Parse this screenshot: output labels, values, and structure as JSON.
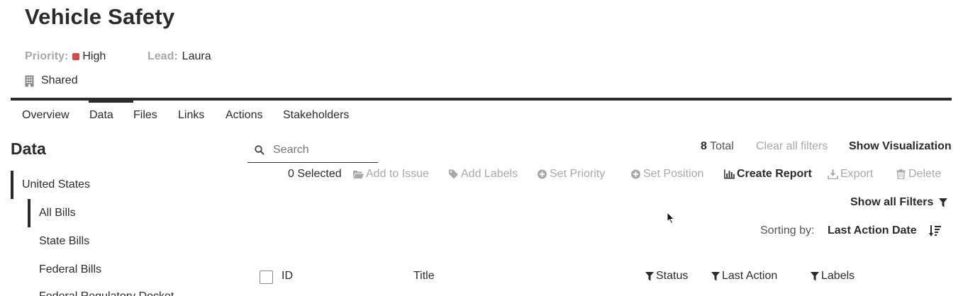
{
  "page": {
    "title": "Vehicle Safety"
  },
  "meta": {
    "priority_label": "Priority:",
    "priority_value": "High",
    "priority_color": "#d24b4b",
    "lead_label": "Lead:",
    "lead_value": "Laura",
    "visibility": "Shared",
    "visibility_icon": "building-icon"
  },
  "tabs": [
    {
      "label": "Overview",
      "active": false
    },
    {
      "label": "Data",
      "active": true
    },
    {
      "label": "Files",
      "active": false
    },
    {
      "label": "Links",
      "active": false
    },
    {
      "label": "Actions",
      "active": false
    },
    {
      "label": "Stakeholders",
      "active": false
    }
  ],
  "sidebar": {
    "heading": "Data",
    "items": [
      {
        "label": "United States",
        "level": 1,
        "selected": true
      },
      {
        "label": "All Bills",
        "level": 2,
        "selected": true
      },
      {
        "label": "State Bills",
        "level": 2,
        "selected": false
      },
      {
        "label": "Federal Bills",
        "level": 2,
        "selected": false
      },
      {
        "label": "Federal Regulatory Docket",
        "level": 2,
        "selected": false
      }
    ]
  },
  "search": {
    "placeholder": "Search",
    "value": "",
    "icon": "search-icon"
  },
  "summary": {
    "total_count": "8",
    "total_label": "Total",
    "clear_filters": "Clear all filters",
    "show_visualization": "Show Visualization"
  },
  "bulk_actions": {
    "selected_text": "0 Selected",
    "add_to_issue": "Add to Issue",
    "add_labels": "Add Labels",
    "set_priority": "Set Priority",
    "set_position": "Set Position",
    "create_report": "Create Report",
    "export": "Export",
    "delete": "Delete"
  },
  "filters": {
    "show_all": "Show all Filters"
  },
  "sorting": {
    "label": "Sorting by:",
    "value": "Last Action Date",
    "direction": "descending"
  },
  "table": {
    "columns": [
      {
        "label": "ID",
        "filterable": false
      },
      {
        "label": "Title",
        "filterable": false
      },
      {
        "label": "Status",
        "filterable": true
      },
      {
        "label": "Last Action",
        "filterable": true
      },
      {
        "label": "Labels",
        "filterable": true
      }
    ]
  }
}
